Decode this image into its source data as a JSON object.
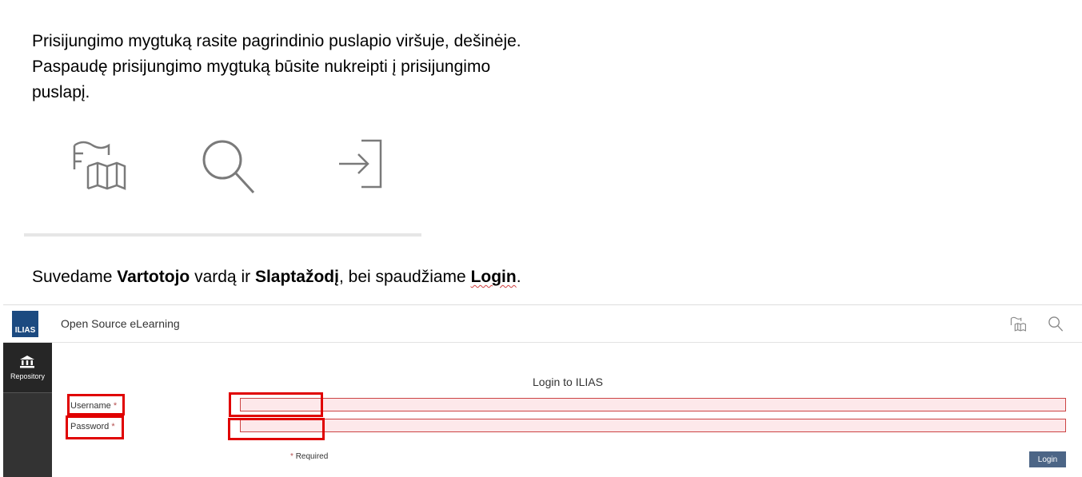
{
  "instructions": {
    "intro": "Prisijungimo mygtuką rasite pagrindinio puslapio viršuje, dešinėje. Paspaudę prisijungimo mygtuką būsite nukreipti į prisijungimo puslapį.",
    "step_prefix": "Suvedame ",
    "step_bold1": "Vartotojo",
    "step_mid1": " vardą ir ",
    "step_bold2": "Slaptažodį",
    "step_mid2": ", bei spaudžiame ",
    "step_bold3": "Login",
    "step_suffix": "."
  },
  "icons": [
    "map-icon",
    "search-icon",
    "login-icon"
  ],
  "ilias": {
    "logo_text": "ILIAS",
    "site_title": "Open Source eLearning",
    "sidebar_items": [
      {
        "label": "Repository",
        "icon": "repository-icon"
      }
    ],
    "login_title": "Login to ILIAS",
    "username_label": "Username",
    "password_label": "Password",
    "required_marker": "*",
    "required_text": "Required",
    "login_button": "Login",
    "username_value": "",
    "password_value": ""
  },
  "colors": {
    "logo_bg": "#1c4a80",
    "sidebar_bg": "#333333",
    "highlight": "#e00000",
    "input_invalid_bg": "#fde8ea",
    "button_bg": "#4c6586"
  }
}
